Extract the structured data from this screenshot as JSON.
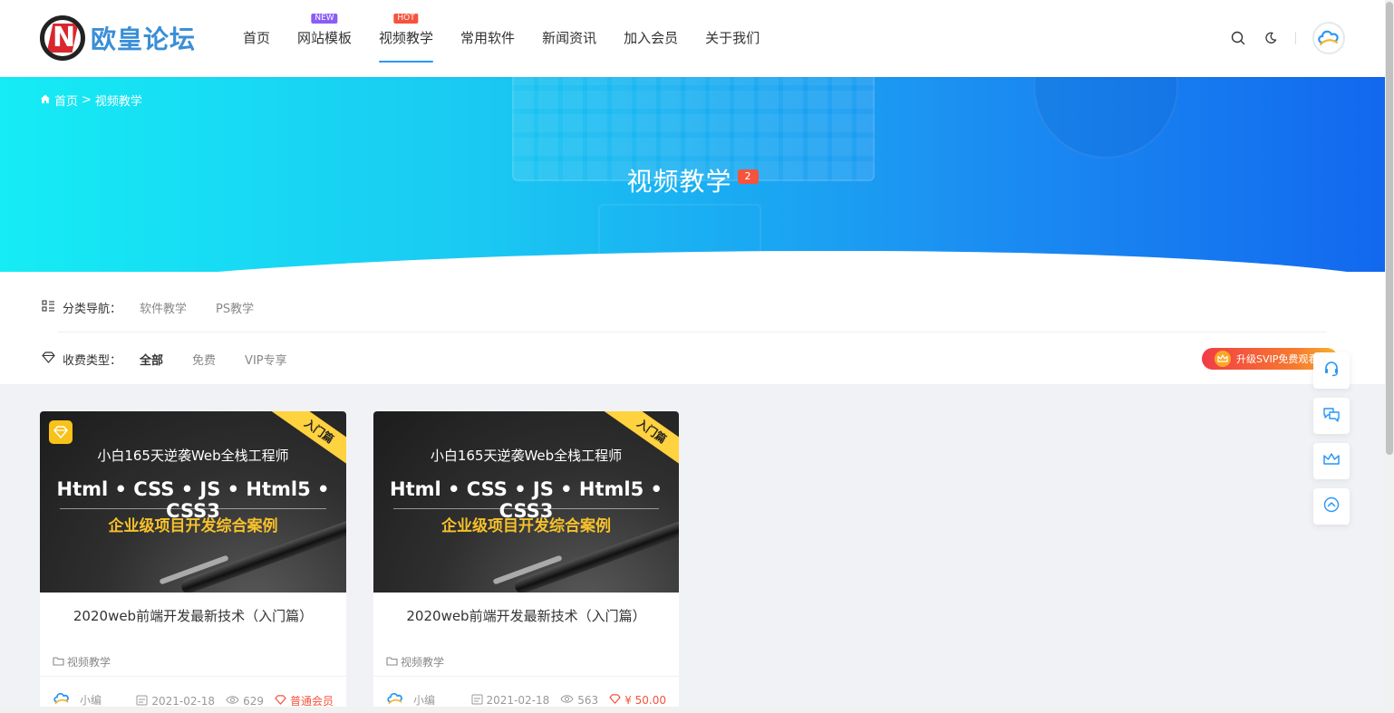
{
  "logo": {
    "text": "欧皇论坛"
  },
  "nav": {
    "items": [
      {
        "label": "首页"
      },
      {
        "label": "网站模板",
        "badge": "NEW"
      },
      {
        "label": "视频教学",
        "badge": "HOT",
        "active": true
      },
      {
        "label": "常用软件"
      },
      {
        "label": "新闻资讯"
      },
      {
        "label": "加入会员"
      },
      {
        "label": "关于我们"
      }
    ]
  },
  "breadcrumb": {
    "home": "首页",
    "sep": ">",
    "current": "视频教学"
  },
  "banner": {
    "title": "视频教学",
    "count": "2"
  },
  "filters": {
    "category_label": "分类导航：",
    "categories": [
      "软件教学",
      "PS教学"
    ],
    "type_label": "收费类型：",
    "types": [
      "全部",
      "免费",
      "VIP专享"
    ],
    "svip_button": "升级SVIP免费观看"
  },
  "cards": [
    {
      "ribbon": "入门篇",
      "thumb_line1": "小白165天逆袭Web全栈工程师",
      "thumb_line2": "Html • CSS • JS • Html5 • CSS3",
      "thumb_line3": "企业级项目开发综合案例",
      "title": "2020web前端开发最新技术（入门篇）",
      "category": "视频教学",
      "author": "小编",
      "date": "2021-02-18",
      "views": "629",
      "price": "普通会员"
    },
    {
      "ribbon": "入门篇",
      "thumb_line1": "小白165天逆袭Web全栈工程师",
      "thumb_line2": "Html • CSS • JS • Html5 • CSS3",
      "thumb_line3": "企业级项目开发综合案例",
      "title": "2020web前端开发最新技术（入门篇）",
      "category": "视频教学",
      "author": "小编",
      "date": "2021-02-18",
      "views": "563",
      "price": "¥ 50.00"
    }
  ],
  "colors": {
    "accent": "#2996f7",
    "hot": "#f5533d",
    "new": "#8b5cf6",
    "gold": "#f6c12b"
  },
  "icons": [
    "search-icon",
    "moon-icon",
    "headset-icon",
    "chat-icon",
    "crown-icon",
    "back-to-top-icon",
    "home-icon",
    "folder-icon",
    "calendar-icon",
    "eye-icon",
    "diamond-icon"
  ]
}
